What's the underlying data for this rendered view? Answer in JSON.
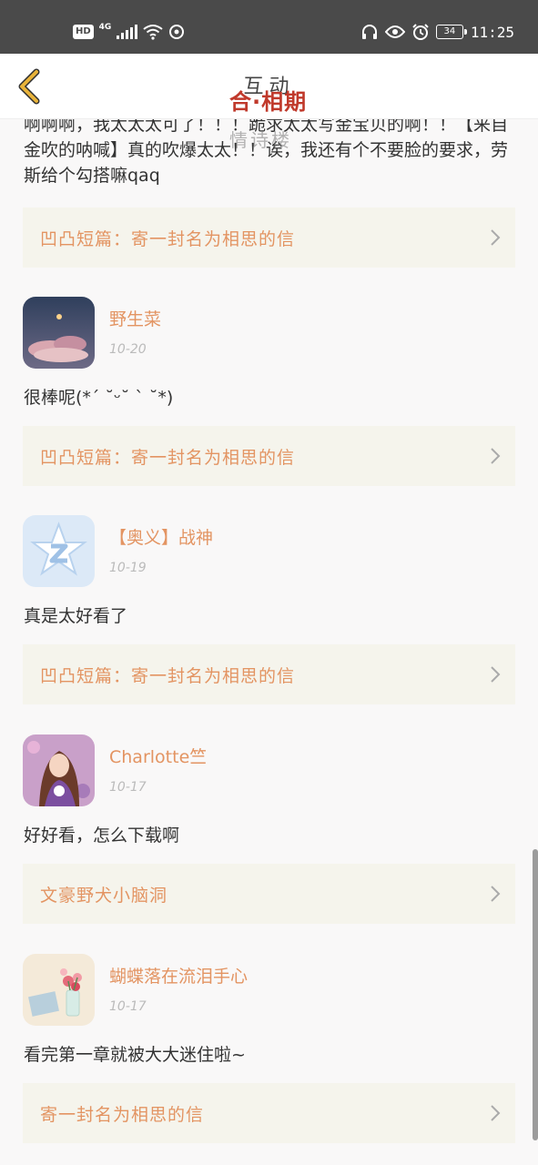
{
  "status_bar": {
    "hd": "HD",
    "network": "4G",
    "battery": "34",
    "time": "11:25"
  },
  "header": {
    "title": "互动",
    "watermark": "合·相期",
    "watermark2": "情诗楼"
  },
  "first_comment": {
    "text": "啊啊啊，我太太太可了！！！跪求太太写金宝贝的啊！！【来自金吹的呐喊】真的吹爆太太！！诶，我还有个不要脸的要求，劳斯给个勾搭嘛qaq",
    "link": "凹凸短篇：寄一封名为相思的信"
  },
  "comments": [
    {
      "name": "野生菜",
      "date": "10-20",
      "text": "很棒呢(*´ ˘ᵕ˘ ` ˘*)",
      "link": "凹凸短篇：寄一封名为相思的信",
      "avatar": "cloud-moon-avatar"
    },
    {
      "name": "【奥义】战神",
      "date": "10-19",
      "text": "真是太好看了",
      "link": "凹凸短篇：寄一封名为相思的信",
      "avatar": "qzone-star-avatar"
    },
    {
      "name": "Charlotte竺",
      "date": "10-17",
      "text": "好好看，怎么下载啊",
      "link": "文豪野犬小脑洞",
      "avatar": "anime-girl-avatar"
    },
    {
      "name": "蝴蝶落在流泪手心",
      "date": "10-17",
      "text": "看完第一章就被大大迷住啦~",
      "link": "寄一封名为相思的信",
      "avatar": "flowers-book-avatar"
    }
  ],
  "colors": {
    "accent": "#e39462",
    "card_bg": "#f5f4ec",
    "status_bar": "#4a4a4a",
    "back_arrow": "#e8b33a"
  }
}
